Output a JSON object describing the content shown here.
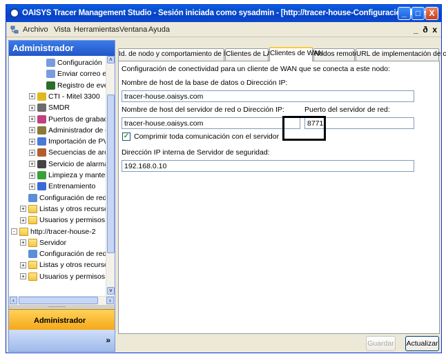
{
  "window": {
    "title": "OAISYS Tracer Management Studio - Sesión iniciada como sysadmin - [http://tracer-house-Configuración de red]",
    "controls": [
      "_",
      "□",
      "X"
    ]
  },
  "menu": {
    "items": [
      "Archivo",
      "Vista",
      "Herramientas",
      "Ventana",
      "Ayuda"
    ],
    "right": "_ ♬ x"
  },
  "left_panel": {
    "header": "Administrador",
    "tree": [
      {
        "label": "Configuración",
        "icon": "pencil-icon",
        "expander": "",
        "indent": 3
      },
      {
        "label": "Enviar correo elec",
        "icon": "pencil-icon",
        "expander": "",
        "indent": 3
      },
      {
        "label": "Registro de event",
        "icon": "log-icon",
        "expander": "",
        "indent": 3
      },
      {
        "label": "CTI - Mitel 3300",
        "icon": "cti-icon",
        "expander": "+",
        "indent": 2
      },
      {
        "label": "SMDR",
        "icon": "printer-icon",
        "expander": "+",
        "indent": 2
      },
      {
        "label": "Puertos de grabación",
        "icon": "ports-icon",
        "expander": "+",
        "indent": 2
      },
      {
        "label": "Administrador de grab",
        "icon": "tools-icon",
        "expander": "+",
        "indent": 2
      },
      {
        "label": "Importación de PVD",
        "icon": "import-icon",
        "expander": "+",
        "indent": 2
      },
      {
        "label": "Secuencias de archiv",
        "icon": "archive-icon",
        "expander": "+",
        "indent": 2
      },
      {
        "label": "Servicio de alarmas",
        "icon": "alarm-icon",
        "expander": "+",
        "indent": 2
      },
      {
        "label": "Limpieza y mantenimie",
        "icon": "cleanup-icon",
        "expander": "+",
        "indent": 2
      },
      {
        "label": "Entrenamiento",
        "icon": "training-icon",
        "expander": "+",
        "indent": 2
      },
      {
        "label": "Configuración de red",
        "icon": "network-icon",
        "expander": "",
        "indent": 1
      },
      {
        "label": "Listas y otros recursos",
        "icon": "folder-icon",
        "expander": "+",
        "indent": 1
      },
      {
        "label": "Usuarios y permisos",
        "icon": "folder-icon",
        "expander": "+",
        "indent": 1
      },
      {
        "label": "http://tracer-house-2",
        "icon": "folder-icon",
        "expander": "-",
        "indent": 0
      },
      {
        "label": "Servidor",
        "icon": "folder-icon",
        "expander": "+",
        "indent": 1
      },
      {
        "label": "Configuración de red",
        "icon": "network-icon",
        "expander": "",
        "indent": 1
      },
      {
        "label": "Listas y otros recursos",
        "icon": "folder-icon",
        "expander": "+",
        "indent": 1
      },
      {
        "label": "Usuarios y permisos",
        "icon": "folder-icon",
        "expander": "+",
        "indent": 1
      }
    ],
    "splitter_dots": "..........",
    "admin_button": "Administrador",
    "bottom_chevron": "»"
  },
  "tabs": [
    {
      "label": "Id. de nodo y comportamiento de los nodos",
      "active": false
    },
    {
      "label": "Clientes de LAN",
      "active": false
    },
    {
      "label": "Clientes de WAN",
      "active": true
    },
    {
      "label": "Nodos remotos",
      "active": false
    },
    {
      "label": "URL de implementación de cliente",
      "active": false
    }
  ],
  "form": {
    "intro": "Configuración de conectividad para un cliente de WAN que se conecta a este nodo:",
    "db_host_label": "Nombre de host de la base de datos o Dirección IP:",
    "db_host_value": "tracer-house.oaisys.com",
    "net_host_label": "Nombre de host del servidor de red o Dirección IP:",
    "net_host_value": "tracer-house.oaisys.com",
    "port_label": "Puerto del servidor de red:",
    "port_value": "8771",
    "compress_label": "Comprimir toda comunicación con el servidor",
    "compress_checked": true,
    "security_ip_label": "Dirección IP interna de Servidor de seguridad:",
    "security_ip_value": "192.168.0.10"
  },
  "buttons": {
    "save": "Guardar",
    "refresh": "Actualizar"
  }
}
